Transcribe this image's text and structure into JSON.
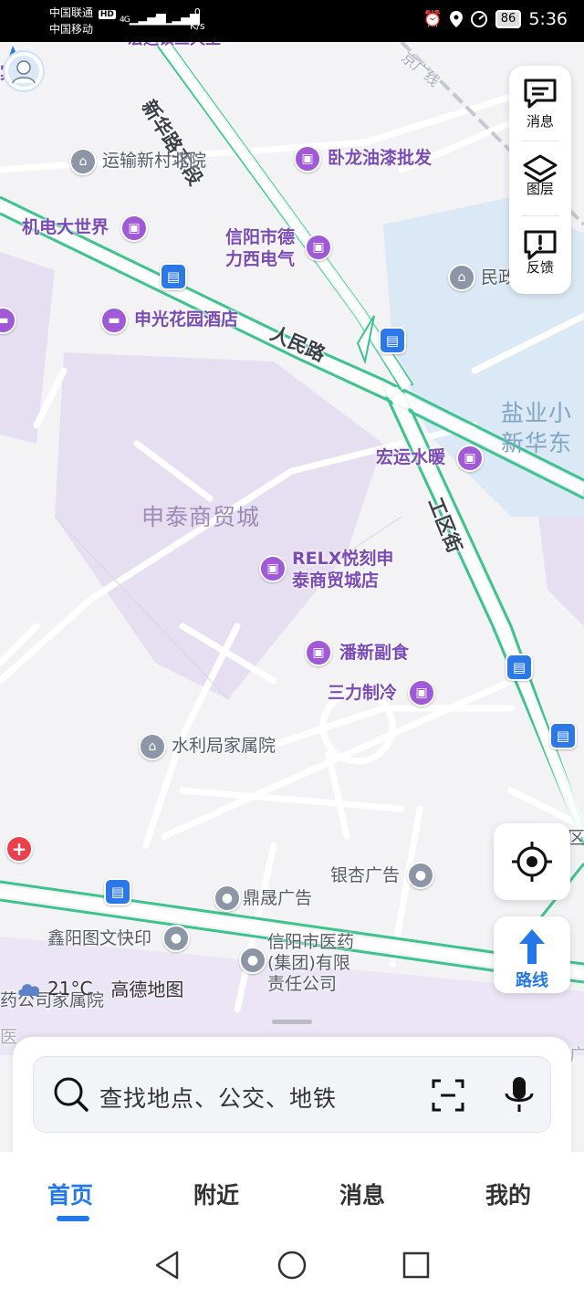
{
  "status_bar": {
    "carrier1": "中国联通",
    "carrier1_badge": "HD",
    "carrier2": "中国移动",
    "signal1": "4G",
    "signal2": "4G",
    "net_speed_value": "0",
    "net_speed_unit": "K/s",
    "battery": "86",
    "time": "5:36"
  },
  "map": {
    "areas": {
      "shentai": "申泰商贸城",
      "yanye_line1": "盐业小",
      "yanye_line2": "新华东"
    },
    "roads": {
      "xinhua_east": "新华路东段",
      "renmin": "人民路",
      "gongqu": "工区街"
    },
    "pois": {
      "binguan": "宾馆",
      "yunshu": "运输新村北院",
      "wolong": "卧龙油漆批发",
      "jidian": "机电大世界",
      "dexin_line1": "信阳市德",
      "dexin_line2": "力西电气",
      "minzheng": "民政",
      "shenguang": "申光花园酒店",
      "hongyun": "宏运水暖",
      "relx_line1": "RELX悦刻申",
      "relx_line2": "泰商贸城店",
      "panxin": "潘新副食",
      "sanli": "三力制冷",
      "shuili": "水利局家属院",
      "yinxing": "银杏广告",
      "dingsheng": "鼎晟广告",
      "xinyang_tuwen": "鑫阳图文快印",
      "yiyao_line1": "信阳市医药",
      "yiyao_line2": "(集团)有限",
      "yiyao_line3": "责任公司",
      "yaogongsi": "药公司家属院"
    },
    "partial": {
      "top_left": "宏运镇三大王",
      "top_right": "京广线",
      "right_fragment": "区",
      "left_bottom": "医",
      "right_bottom": "广"
    }
  },
  "side_panel": {
    "messages": "消息",
    "layers": "图层",
    "feedback": "反馈"
  },
  "route_button": "路线",
  "weather": {
    "temp": "21°C",
    "brand": "高德地图"
  },
  "search": {
    "placeholder": "查找地点、公交、地铁"
  },
  "tabs": {
    "home": "首页",
    "nearby": "附近",
    "messages": "消息",
    "mine": "我的"
  },
  "colors": {
    "accent": "#2278e9",
    "poi_purple": "#a05ad8",
    "road_green": "#3cc48c",
    "area_purple": "#e6dff2",
    "water_blue": "#dbe8f5"
  }
}
